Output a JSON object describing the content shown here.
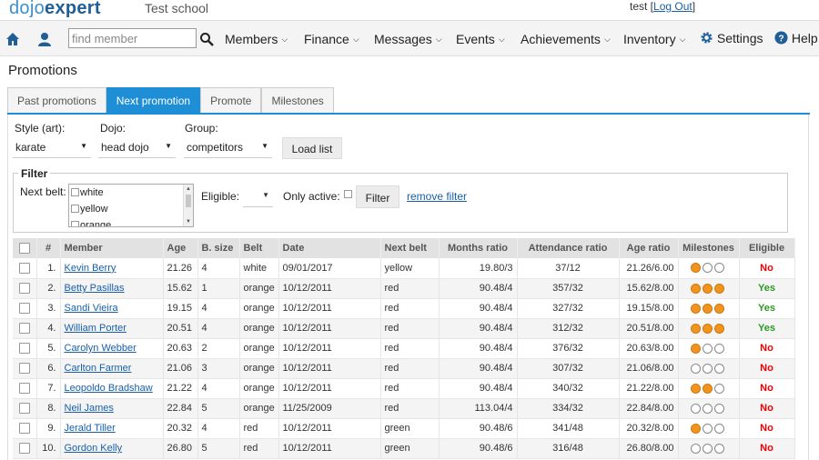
{
  "app": {
    "logo_part1": "dojo",
    "logo_part2": "expert",
    "school": "Test school",
    "user": "test",
    "logout_label": "Log Out"
  },
  "nav": {
    "search_placeholder": "find member",
    "items": [
      {
        "label": "Members"
      },
      {
        "label": "Finance"
      },
      {
        "label": "Messages"
      },
      {
        "label": "Events"
      },
      {
        "label": "Achievements"
      },
      {
        "label": "Inventory"
      }
    ],
    "settings_label": "Settings",
    "help_label": "Help"
  },
  "page": {
    "title": "Promotions",
    "tabs": [
      {
        "label": "Past promotions",
        "active": false
      },
      {
        "label": "Next promotion",
        "active": true
      },
      {
        "label": "Promote",
        "active": false
      },
      {
        "label": "Milestones",
        "active": false
      }
    ]
  },
  "selectors": {
    "style_label": "Style (art):",
    "style_value": "karate",
    "dojo_label": "Dojo:",
    "dojo_value": "head dojo",
    "group_label": "Group:",
    "group_value": "competitors",
    "load_button": "Load list"
  },
  "filter": {
    "legend": "Filter",
    "next_belt_label": "Next belt:",
    "belt_options": [
      "white",
      "yellow",
      "orange"
    ],
    "eligible_label": "Eligible:",
    "eligible_value": "",
    "only_active_label": "Only active:",
    "filter_button": "Filter",
    "remove_filter": "remove filter"
  },
  "table": {
    "columns": [
      "#",
      "Member",
      "Age",
      "B. size",
      "Belt",
      "Date",
      "Next belt",
      "Months ratio",
      "Attendance ratio",
      "Age ratio",
      "Milestones",
      "Eligible"
    ],
    "rows": [
      {
        "num": "1.",
        "member": "Kevin Berry",
        "age": "21.26",
        "bsize": "4",
        "belt": "white",
        "date": "09/01/2017",
        "next_belt": "yellow",
        "months_ratio": "19.80/3",
        "attendance_ratio": "37/12",
        "age_ratio": "21.26/6.00",
        "milestones": [
          1,
          0,
          0
        ],
        "eligible": "No"
      },
      {
        "num": "2.",
        "member": "Betty Pasillas",
        "age": "15.62",
        "bsize": "1",
        "belt": "orange",
        "date": "10/12/2011",
        "next_belt": "red",
        "months_ratio": "90.48/4",
        "attendance_ratio": "357/32",
        "age_ratio": "15.62/8.00",
        "milestones": [
          1,
          1,
          1
        ],
        "eligible": "Yes"
      },
      {
        "num": "3.",
        "member": "Sandi Vieira",
        "age": "19.15",
        "bsize": "4",
        "belt": "orange",
        "date": "10/12/2011",
        "next_belt": "red",
        "months_ratio": "90.48/4",
        "attendance_ratio": "327/32",
        "age_ratio": "19.15/8.00",
        "milestones": [
          1,
          1,
          1
        ],
        "eligible": "Yes"
      },
      {
        "num": "4.",
        "member": "William Porter",
        "age": "20.51",
        "bsize": "4",
        "belt": "orange",
        "date": "10/12/2011",
        "next_belt": "red",
        "months_ratio": "90.48/4",
        "attendance_ratio": "312/32",
        "age_ratio": "20.51/8.00",
        "milestones": [
          1,
          1,
          1
        ],
        "eligible": "Yes"
      },
      {
        "num": "5.",
        "member": "Carolyn Webber",
        "age": "20.63",
        "bsize": "2",
        "belt": "orange",
        "date": "10/12/2011",
        "next_belt": "red",
        "months_ratio": "90.48/4",
        "attendance_ratio": "376/32",
        "age_ratio": "20.63/8.00",
        "milestones": [
          1,
          0,
          0
        ],
        "eligible": "No"
      },
      {
        "num": "6.",
        "member": "Carlton Farmer",
        "age": "21.06",
        "bsize": "3",
        "belt": "orange",
        "date": "10/12/2011",
        "next_belt": "red",
        "months_ratio": "90.48/4",
        "attendance_ratio": "307/32",
        "age_ratio": "21.06/8.00",
        "milestones": [
          0,
          0,
          0
        ],
        "eligible": "No"
      },
      {
        "num": "7.",
        "member": "Leopoldo Bradshaw",
        "age": "21.22",
        "bsize": "4",
        "belt": "orange",
        "date": "10/12/2011",
        "next_belt": "red",
        "months_ratio": "90.48/4",
        "attendance_ratio": "340/32",
        "age_ratio": "21.22/8.00",
        "milestones": [
          1,
          1,
          0
        ],
        "eligible": "No"
      },
      {
        "num": "8.",
        "member": "Neil James",
        "age": "22.84",
        "bsize": "5",
        "belt": "orange",
        "date": "11/25/2009",
        "next_belt": "red",
        "months_ratio": "113.04/4",
        "attendance_ratio": "334/32",
        "age_ratio": "22.84/8.00",
        "milestones": [
          0,
          0,
          0
        ],
        "eligible": "No"
      },
      {
        "num": "9.",
        "member": "Jerald Tiller",
        "age": "20.32",
        "bsize": "4",
        "belt": "red",
        "date": "10/12/2011",
        "next_belt": "green",
        "months_ratio": "90.48/6",
        "attendance_ratio": "341/48",
        "age_ratio": "20.32/8.00",
        "milestones": [
          1,
          0,
          0
        ],
        "eligible": "No"
      },
      {
        "num": "10.",
        "member": "Gordon Kelly",
        "age": "26.80",
        "bsize": "5",
        "belt": "red",
        "date": "10/12/2011",
        "next_belt": "green",
        "months_ratio": "90.48/6",
        "attendance_ratio": "316/48",
        "age_ratio": "26.80/8.00",
        "milestones": [
          0,
          0,
          0
        ],
        "eligible": "No"
      }
    ]
  },
  "icons": {
    "home": "home-icon",
    "member": "user-icon",
    "search": "search-icon",
    "settings": "gear-icon",
    "help": "help-icon"
  },
  "colors": {
    "accent": "#1e8fd6",
    "milestone_done": "#f0941e",
    "eligible_no": "#e00000",
    "eligible_yes": "#2a9a20"
  }
}
